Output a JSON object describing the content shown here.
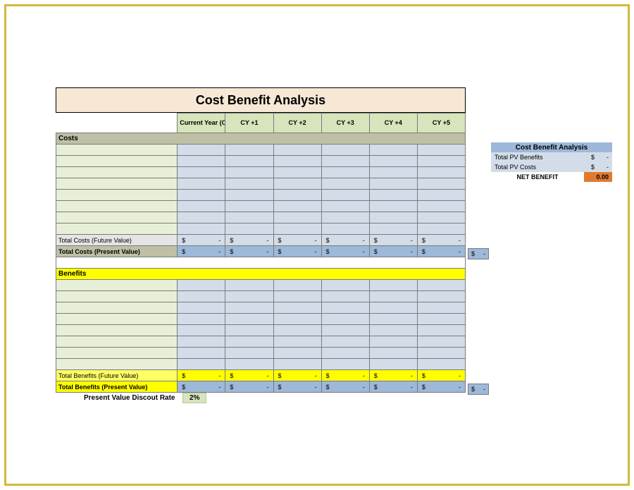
{
  "title": "Cost Benefit Analysis",
  "year_headers": [
    "Current Year (CY)",
    "CY +1",
    "CY +2",
    "CY +3",
    "CY +4",
    "CY +5"
  ],
  "costs": {
    "section_label": "Costs",
    "rows": 8,
    "future_label": "Total Costs (Future Value)",
    "present_label": "Total Costs (Present Value)"
  },
  "benefits": {
    "section_label": "Benefits",
    "rows": 8,
    "future_label": "Total Benefits (Future Value)",
    "present_label": "Total Benefits (Present Value)"
  },
  "money_sym": "$",
  "money_dash": "-",
  "summary": {
    "title": "Cost Benefit Analysis",
    "rows": [
      {
        "label": "Total PV Benefits",
        "sym": "$",
        "val": "-"
      },
      {
        "label": "Total PV Costs",
        "sym": "$",
        "val": "-"
      }
    ],
    "net_label": "NET BENEFIT",
    "net_value": "0.00"
  },
  "discount": {
    "label": "Present Value Discout Rate",
    "value": "2%"
  }
}
